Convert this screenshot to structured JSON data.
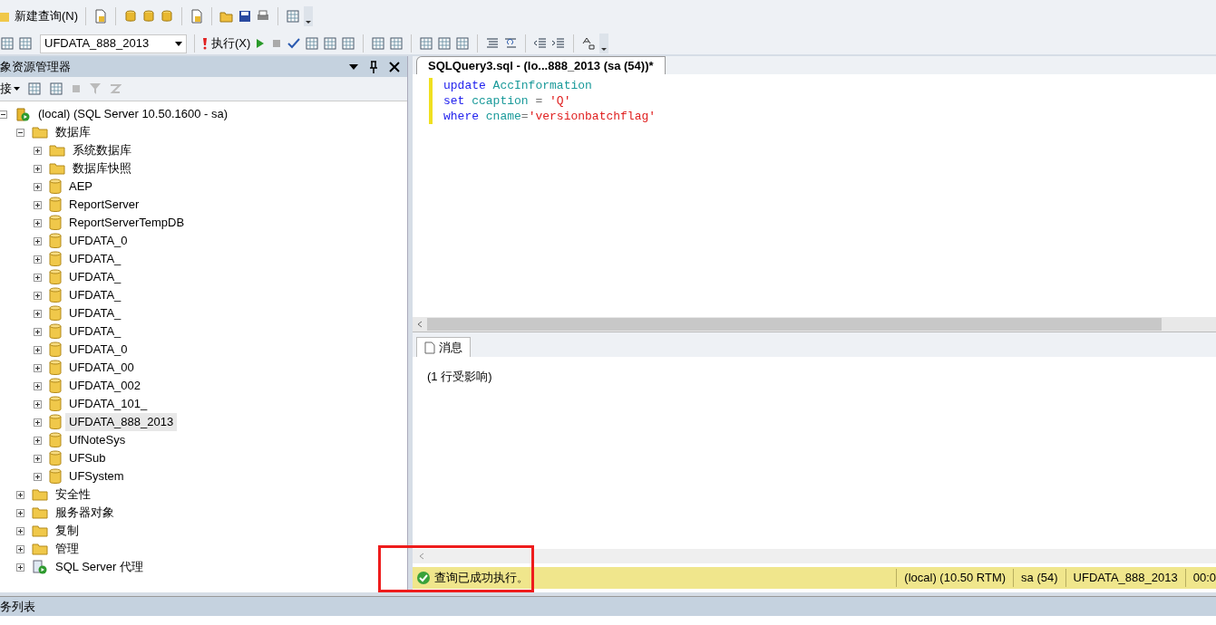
{
  "toolbar_1": {
    "new_query": "新建查询(N)"
  },
  "toolbar_2": {
    "database": "UFDATA_888_2013",
    "execute": "执行(X)"
  },
  "object_explorer": {
    "title": "象资源管理器",
    "connect": "接",
    "tree": [
      {
        "label": "(local) (SQL Server 10.50.1600 - sa)",
        "kind": "server",
        "expanded": true,
        "selected": false,
        "children": [
          {
            "label": "数据库",
            "kind": "folder",
            "expanded": true,
            "selected": false,
            "children": [
              {
                "label": "系统数据库",
                "kind": "folder",
                "expanded": false,
                "selected": false
              },
              {
                "label": "数据库快照",
                "kind": "folder",
                "expanded": false,
                "selected": false
              },
              {
                "label": "AEP",
                "kind": "database",
                "expanded": false,
                "selected": false
              },
              {
                "label": "ReportServer",
                "kind": "database",
                "expanded": false,
                "selected": false
              },
              {
                "label": "ReportServerTempDB",
                "kind": "database",
                "expanded": false,
                "selected": false
              },
              {
                "label": "UFDATA_0",
                "kind": "database",
                "expanded": false,
                "selected": false
              },
              {
                "label": "UFDATA_",
                "kind": "database",
                "expanded": false,
                "selected": false
              },
              {
                "label": "UFDATA_",
                "kind": "database",
                "expanded": false,
                "selected": false
              },
              {
                "label": "UFDATA_",
                "kind": "database",
                "expanded": false,
                "selected": false
              },
              {
                "label": "UFDATA_",
                "kind": "database",
                "expanded": false,
                "selected": false
              },
              {
                "label": "UFDATA_",
                "kind": "database",
                "expanded": false,
                "selected": false
              },
              {
                "label": "UFDATA_0",
                "kind": "database",
                "expanded": false,
                "selected": false
              },
              {
                "label": "UFDATA_00",
                "kind": "database",
                "expanded": false,
                "selected": false
              },
              {
                "label": "UFDATA_002",
                "kind": "database",
                "expanded": false,
                "selected": false
              },
              {
                "label": "UFDATA_101_",
                "kind": "database",
                "expanded": false,
                "selected": false
              },
              {
                "label": "UFDATA_888_2013",
                "kind": "database",
                "expanded": false,
                "selected": true
              },
              {
                "label": "UfNoteSys",
                "kind": "database",
                "expanded": false,
                "selected": false
              },
              {
                "label": "UFSub",
                "kind": "database",
                "expanded": false,
                "selected": false
              },
              {
                "label": "UFSystem",
                "kind": "database",
                "expanded": false,
                "selected": false
              }
            ]
          },
          {
            "label": "安全性",
            "kind": "folder",
            "expanded": false,
            "selected": false
          },
          {
            "label": "服务器对象",
            "kind": "folder",
            "expanded": false,
            "selected": false
          },
          {
            "label": "复制",
            "kind": "folder",
            "expanded": false,
            "selected": false
          },
          {
            "label": "管理",
            "kind": "folder",
            "expanded": false,
            "selected": false
          },
          {
            "label": "SQL Server 代理",
            "kind": "agent",
            "expanded": false,
            "selected": false
          }
        ]
      }
    ]
  },
  "editor": {
    "tab": "SQLQuery3.sql - (lo...888_2013 (sa (54))*",
    "lines": [
      [
        {
          "kind": "keyword",
          "text": "update"
        },
        {
          "kind": "ident",
          "text": " AccInformation"
        }
      ],
      [
        {
          "kind": "keyword",
          "text": "set"
        },
        {
          "kind": "ident",
          "text": " ccaption"
        },
        {
          "kind": "op",
          "text": " = "
        },
        {
          "kind": "string",
          "text": "'Q'"
        }
      ],
      [
        {
          "kind": "keyword",
          "text": "where"
        },
        {
          "kind": "ident",
          "text": " cname"
        },
        {
          "kind": "op",
          "text": "="
        },
        {
          "kind": "string",
          "text": "'versionbatchflag'"
        }
      ]
    ]
  },
  "results": {
    "tab": "消息",
    "message": "(1 行受影响)"
  },
  "status_bar": {
    "message": "查询已成功执行。",
    "server": "(local) (10.50 RTM)",
    "user": "sa (54)",
    "database": "UFDATA_888_2013",
    "time": "00:0"
  },
  "bottom_panel": {
    "title": "务列表"
  }
}
